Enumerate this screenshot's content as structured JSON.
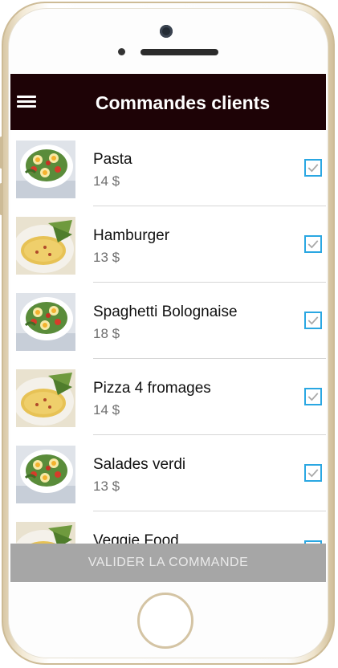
{
  "app": {
    "title": "Commandes clients",
    "menu_icon": "hamburger-menu-icon"
  },
  "orders": [
    {
      "name": "Pasta",
      "price": "14 $",
      "checked": true,
      "image": "salad-bowl"
    },
    {
      "name": "Hamburger",
      "price": "13 $",
      "checked": true,
      "image": "omelette-plate"
    },
    {
      "name": "Spaghetti Bolognaise",
      "price": "18 $",
      "checked": true,
      "image": "salad-bowl"
    },
    {
      "name": "Pizza 4 fromages",
      "price": "14 $",
      "checked": true,
      "image": "omelette-plate"
    },
    {
      "name": "Salades verdi",
      "price": "13 $",
      "checked": true,
      "image": "salad-bowl"
    },
    {
      "name": "Veggie Food",
      "price": "",
      "checked": true,
      "image": "omelette-plate"
    }
  ],
  "footer": {
    "validate_label": "VALIDER LA COMMANDE"
  },
  "colors": {
    "appbar": "#1e0306",
    "checkbox": "#2aa7e2",
    "validate_button": "#a6a6a6"
  }
}
